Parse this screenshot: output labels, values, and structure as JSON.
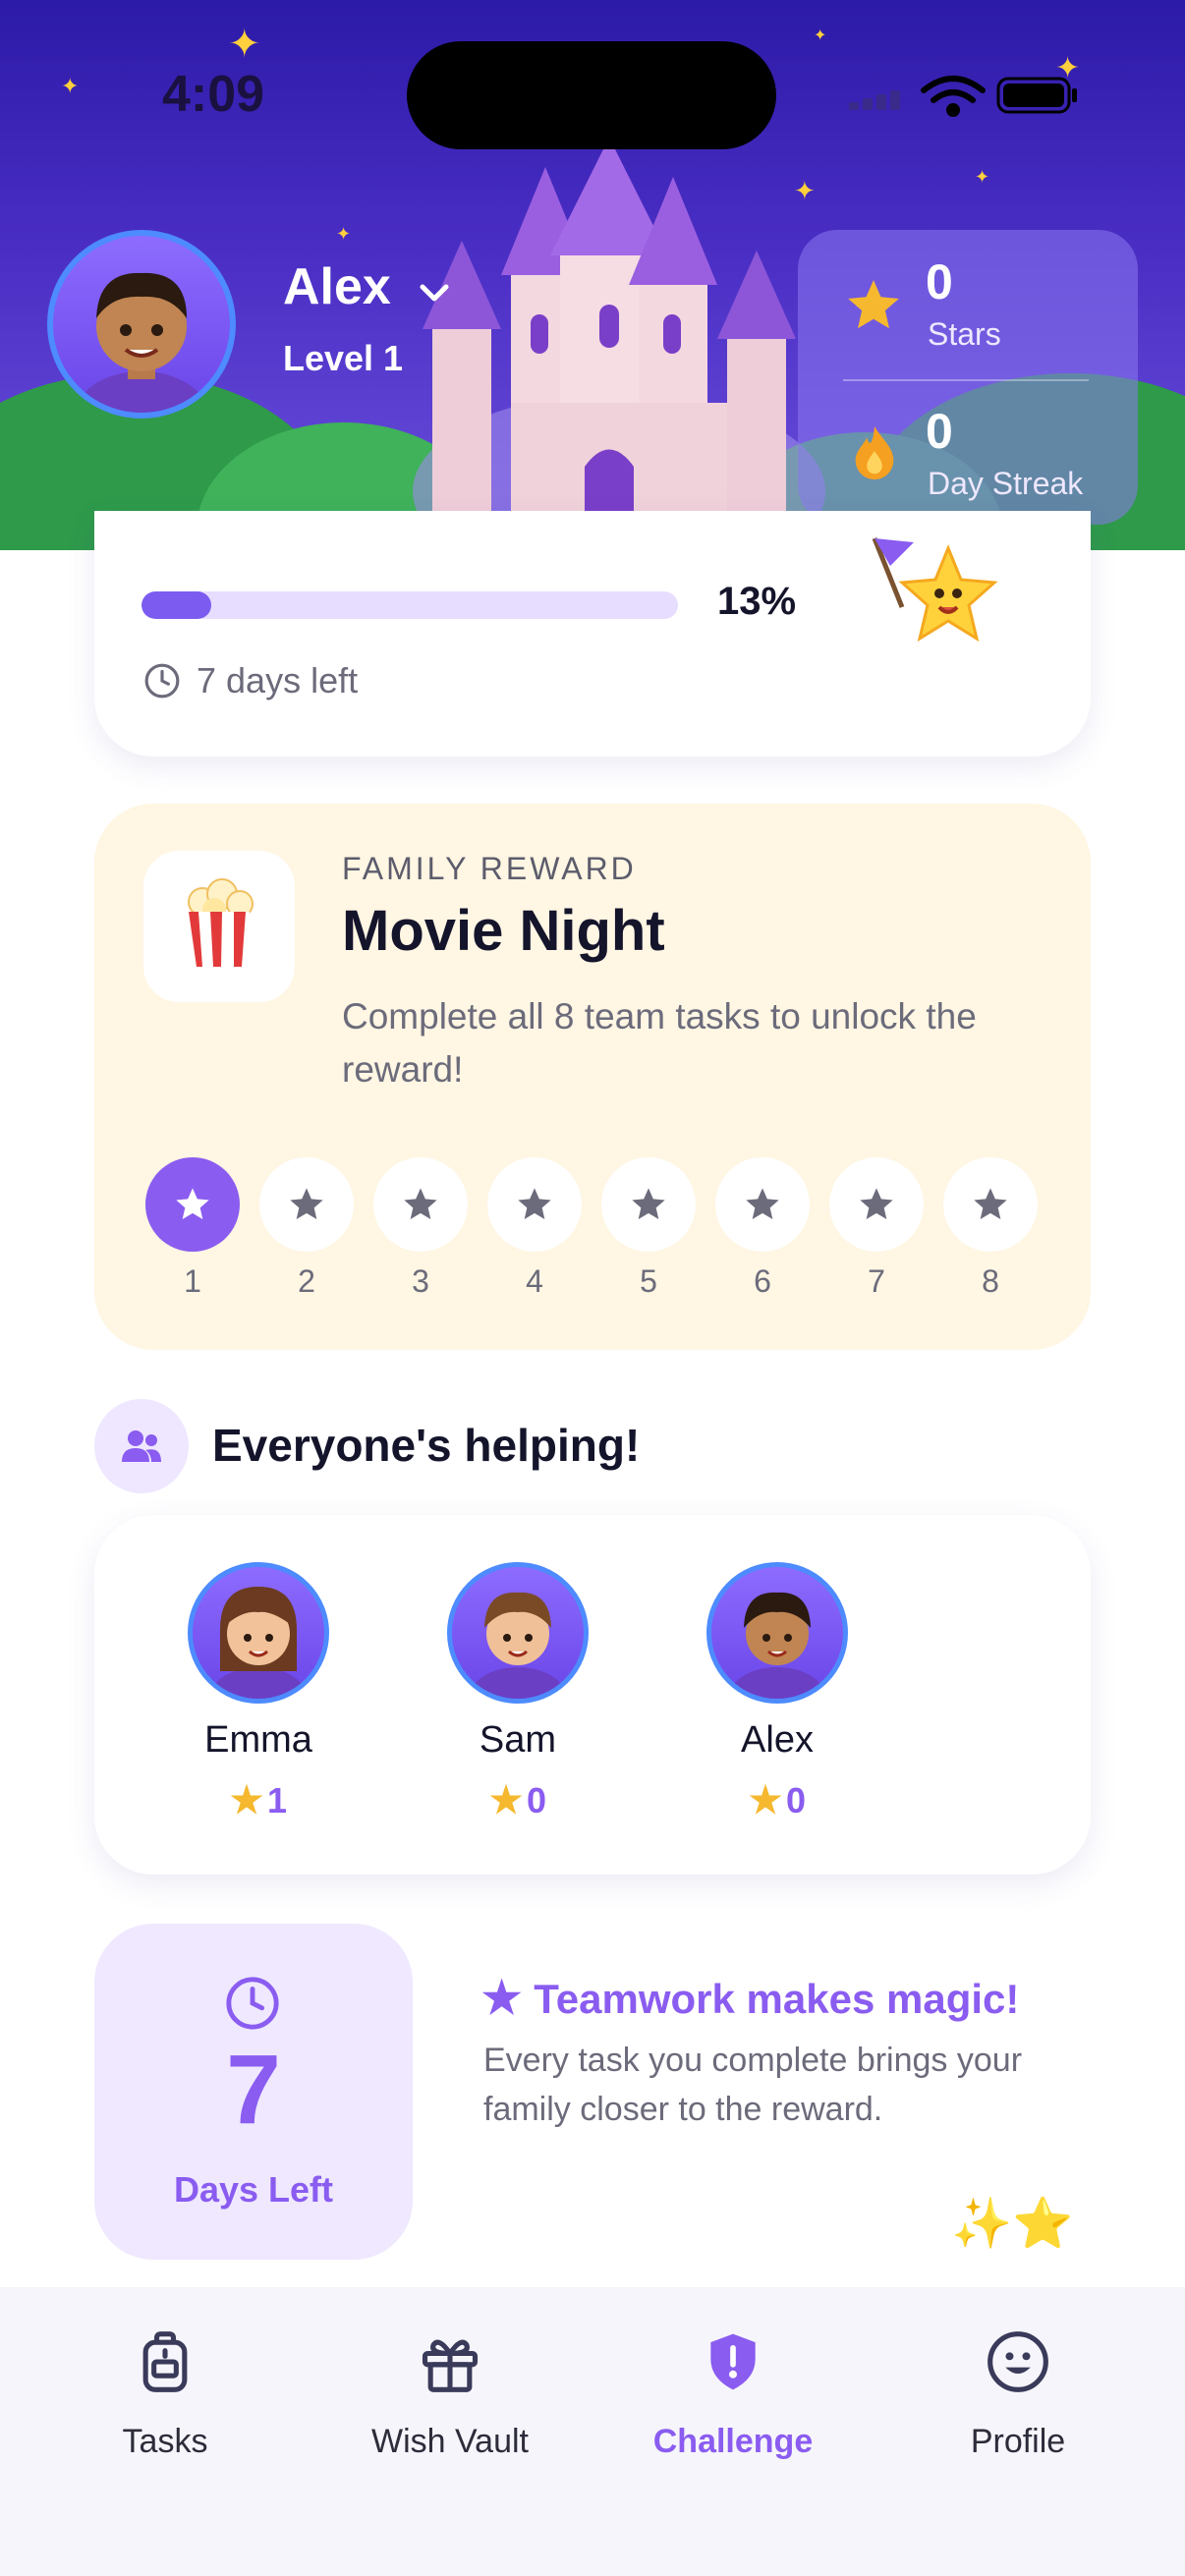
{
  "status_bar": {
    "time": "4:09"
  },
  "user": {
    "name": "Alex",
    "level": "Level 1"
  },
  "stats": [
    {
      "value": "0",
      "label": "Stars",
      "icon": "star-icon"
    },
    {
      "value": "0",
      "label": "Day Streak",
      "icon": "flame-icon"
    }
  ],
  "progress": {
    "fraction": 0.13,
    "percent_label": "13%",
    "days_left": "7 days left"
  },
  "reward": {
    "eyebrow": "FAMILY REWARD",
    "title": "Movie Night",
    "description": "Complete all 8 team tasks to unlock the reward!",
    "icon": "popcorn-icon",
    "steps": [
      {
        "number": "1",
        "done": true
      },
      {
        "number": "2",
        "done": false
      },
      {
        "number": "3",
        "done": false
      },
      {
        "number": "4",
        "done": false
      },
      {
        "number": "5",
        "done": false
      },
      {
        "number": "6",
        "done": false
      },
      {
        "number": "7",
        "done": false
      },
      {
        "number": "8",
        "done": false
      }
    ]
  },
  "helpers": {
    "title": "Everyone's helping!",
    "members": [
      {
        "name": "Emma",
        "stars": "1"
      },
      {
        "name": "Sam",
        "stars": "0"
      },
      {
        "name": "Alex",
        "stars": "0"
      }
    ]
  },
  "countdown": {
    "value": "7",
    "label": "Days Left"
  },
  "teamwork": {
    "title": "Teamwork makes magic!",
    "description": "Every task you complete brings your family closer to the reward."
  },
  "tabs": [
    {
      "label": "Tasks",
      "icon": "backpack-icon",
      "active": false
    },
    {
      "label": "Wish Vault",
      "icon": "gift-icon",
      "active": false
    },
    {
      "label": "Challenge",
      "icon": "shield-icon",
      "active": true
    },
    {
      "label": "Profile",
      "icon": "smiley-icon",
      "active": false
    }
  ],
  "colors": {
    "accent": "#8a5cf0",
    "header_top": "#2c1aa8",
    "reward_bg": "#fff6e3",
    "star": "#f5b82e"
  }
}
